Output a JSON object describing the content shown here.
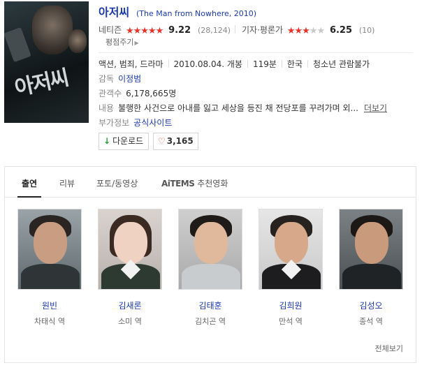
{
  "movie": {
    "title": "아저씨",
    "title_en": "(The Man from Nowhere, 2010)",
    "poster_text": "아저씨"
  },
  "ratings": {
    "netizen": {
      "label": "네티즌",
      "stars_on": "★★★★★",
      "stars_off": "",
      "score": "9.22",
      "count": "(28,124)",
      "link": "평점주기"
    },
    "critic": {
      "label": "기자·평론가",
      "stars_on": "★★★",
      "stars_off": "★★",
      "score": "6.25",
      "count": "(10)"
    }
  },
  "meta": {
    "genre": "액션, 범죄, 드라마",
    "release": "2010.08.04. 개봉",
    "runtime": "119분",
    "country": "한국",
    "rating": "청소년 관람불가",
    "director_label": "감독",
    "director": "이정범",
    "audience_label": "관객수",
    "audience": "6,178,665명",
    "plot_label": "내용",
    "plot": "불행한 사건으로 아내를 잃고 세상을 등진 채 전당포를 꾸려가며 외...",
    "more": "더보기",
    "extra_label": "부가정보",
    "extra": "공식사이트"
  },
  "buttons": {
    "download": "다운로드",
    "download_icon": "↓",
    "like_icon": "♡",
    "like_count": "3,165"
  },
  "tabs": {
    "cast": "출연",
    "review": "리뷰",
    "photo": "포토/동영상",
    "aitems": "AiTEMS",
    "recommend": "추천영화"
  },
  "cast": [
    {
      "name": "원빈",
      "role": "차태식 역"
    },
    {
      "name": "김새론",
      "role": "소미 역"
    },
    {
      "name": "김태훈",
      "role": "김치곤 역"
    },
    {
      "name": "김희원",
      "role": "만석 역"
    },
    {
      "name": "김성오",
      "role": "종석 역"
    }
  ],
  "view_all": "전체보기",
  "colors": {
    "link": "#1b3aa8",
    "star": "#e8352b",
    "download_icon": "#2a9d3c"
  }
}
